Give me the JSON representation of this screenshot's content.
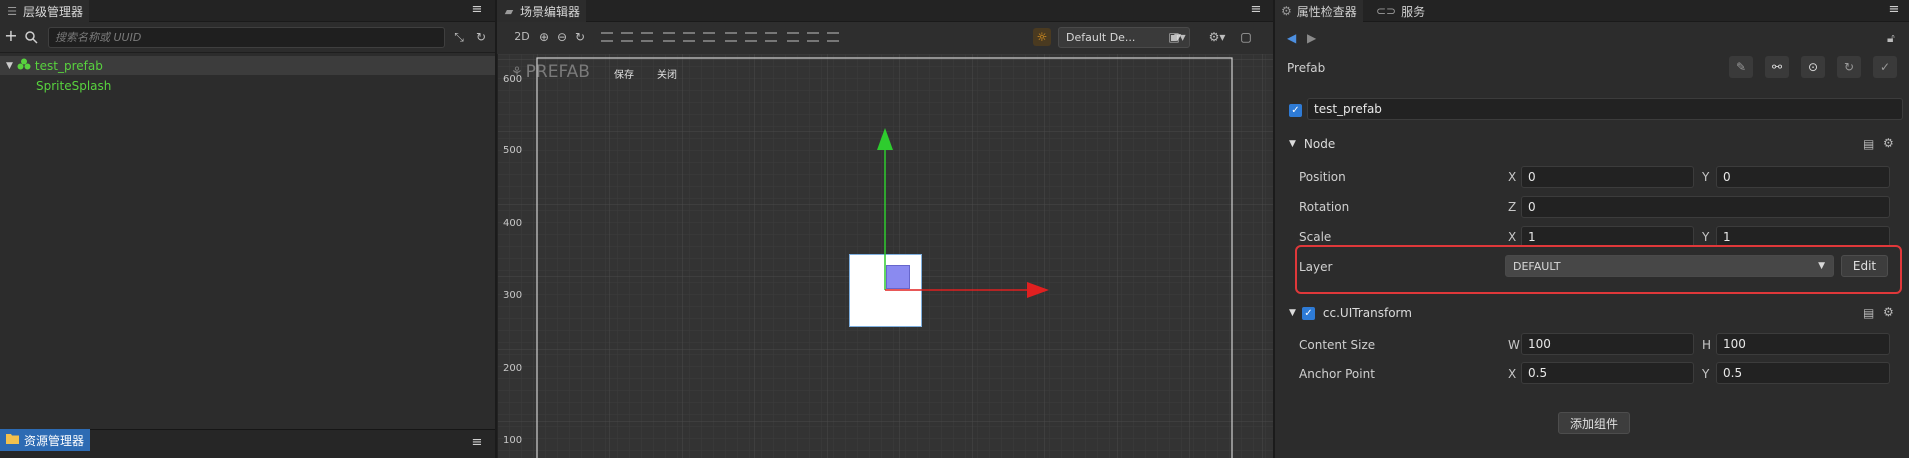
{
  "hierarchy": {
    "tab_label": "层级管理器",
    "search_placeholder": "搜索名称或 UUID",
    "nodes": [
      {
        "label": "test_prefab"
      },
      {
        "label": "SpriteSplash"
      }
    ]
  },
  "assets": {
    "tab_label": "资源管理器"
  },
  "scene": {
    "tab_label": "场景编辑器",
    "mode_label": "2D",
    "layout_select": "Default De...",
    "prefab_label": "PREFAB",
    "save_label": "保存",
    "close_label": "关闭",
    "ruler": [
      "600",
      "500",
      "400",
      "300",
      "200",
      "100"
    ]
  },
  "inspector": {
    "tab_label": "属性检查器",
    "service_tab_label": "服务",
    "prefab_title": "Prefab",
    "node_name": "test_prefab",
    "node_section": "Node",
    "position_label": "Position",
    "position": {
      "x": "0",
      "y": "0"
    },
    "rotation_label": "Rotation",
    "rotation": {
      "z": "0"
    },
    "scale_label": "Scale",
    "scale": {
      "x": "1",
      "y": "1"
    },
    "layer_label": "Layer",
    "layer_value": "DEFAULT",
    "edit_label": "Edit",
    "uitransform_section": "cc.UITransform",
    "content_size_label": "Content Size",
    "content_size": {
      "w": "100",
      "h": "100"
    },
    "anchor_label": "Anchor Point",
    "anchor": {
      "x": "0.5",
      "y": "0.5"
    },
    "add_component_label": "添加组件",
    "axis_labels": {
      "x": "X",
      "y": "Y",
      "z": "Z",
      "w": "W",
      "h": "H"
    }
  },
  "colors": {
    "accent_blue": "#2d6bb3",
    "node_green": "#58d23e",
    "highlight_red": "#e0383a",
    "axis_x_red": "#e02020",
    "axis_y_green": "#2ecc2e"
  }
}
